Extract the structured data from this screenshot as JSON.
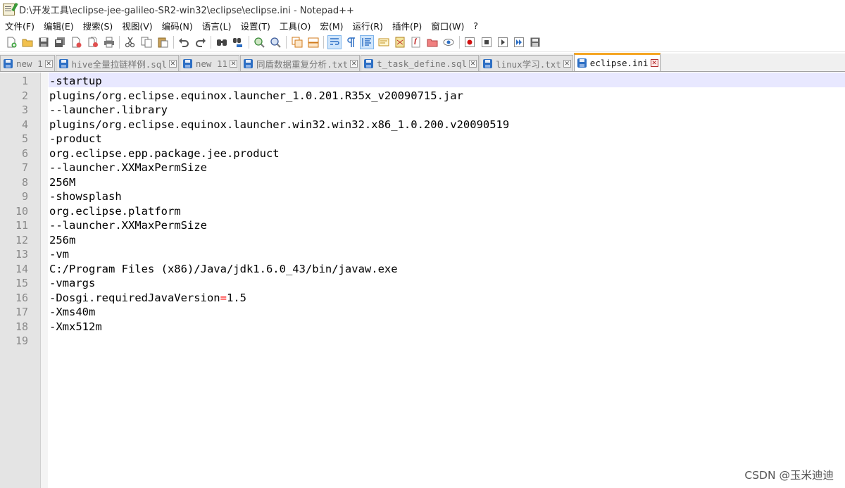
{
  "window": {
    "title": "D:\\开发工具\\eclipse-jee-galileo-SR2-win32\\eclipse\\eclipse.ini - Notepad++"
  },
  "menu": [
    "文件(F)",
    "编辑(E)",
    "搜索(S)",
    "视图(V)",
    "编码(N)",
    "语言(L)",
    "设置(T)",
    "工具(O)",
    "宏(M)",
    "运行(R)",
    "插件(P)",
    "窗口(W)",
    "?"
  ],
  "tabs": [
    {
      "label": "new 1",
      "active": false
    },
    {
      "label": "hive全量拉链样例.sql",
      "active": false
    },
    {
      "label": "new 11",
      "active": false
    },
    {
      "label": "同盾数据重复分析.txt",
      "active": false
    },
    {
      "label": "t_task_define.sql",
      "active": false
    },
    {
      "label": "linux学习.txt",
      "active": false
    },
    {
      "label": "eclipse.ini",
      "active": true
    }
  ],
  "editor": {
    "line_numbers": [
      "1",
      "2",
      "3",
      "4",
      "5",
      "6",
      "7",
      "8",
      "9",
      "10",
      "11",
      "12",
      "13",
      "14",
      "15",
      "16",
      "17",
      "18",
      "19"
    ],
    "lines": [
      "-startup",
      "plugins/org.eclipse.equinox.launcher_1.0.201.R35x_v20090715.jar",
      "--launcher.library",
      "plugins/org.eclipse.equinox.launcher.win32.win32.x86_1.0.200.v20090519",
      "-product",
      "org.eclipse.epp.package.jee.product",
      "--launcher.XXMaxPermSize",
      "256M",
      "-showsplash",
      "org.eclipse.platform",
      "--launcher.XXMaxPermSize",
      "256m",
      "-vm",
      "C:/Program Files (x86)/Java/jdk1.6.0_43/bin/javaw.exe",
      "-vmargs",
      "-Dosgi.requiredJavaVersion=1.5",
      "-Xms40m",
      "-Xmx512m",
      ""
    ],
    "highlight_color": "#ff0000"
  },
  "watermark": "CSDN @玉米迪迪"
}
